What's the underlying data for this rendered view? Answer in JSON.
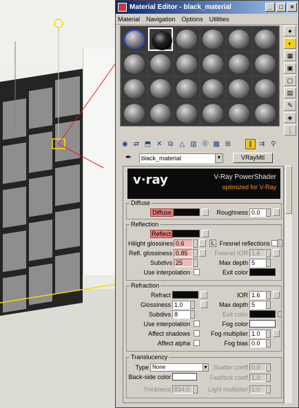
{
  "window": {
    "title": "Material Editor - black_material"
  },
  "menu": [
    "Material",
    "Navigation",
    "Options",
    "Utilities"
  ],
  "material": {
    "name": "black_material",
    "type": "VRayMtl"
  },
  "banner": {
    "logo": "v·ray",
    "title": "V-Ray PowerShader",
    "subtitle": "optimized for V-Ray"
  },
  "diffuse": {
    "group": "Diffuse",
    "diffuse_label": "Diffuse",
    "roughness_label": "Roughness",
    "roughness": "0.0"
  },
  "reflection": {
    "group": "Reflection",
    "reflect_label": "Reflect",
    "hilight_label": "Hilight glossiness",
    "hilight": "0.6",
    "refl_gloss_label": "Refl. glossiness",
    "refl_gloss": "0.85",
    "subdivs_label": "Subdivs",
    "subdivs": "25",
    "use_interp_label": "Use interpolation",
    "l_label": "L",
    "fresnel_label": "Fresnel reflections",
    "fresnel_ior_label": "Fresnel IOR",
    "fresnel_ior": "1.6",
    "max_depth_label": "Max depth",
    "max_depth": "5",
    "exit_color_label": "Exit color"
  },
  "refraction": {
    "group": "Refraction",
    "refract_label": "Refract",
    "glossiness_label": "Glossiness",
    "glossiness": "1.0",
    "subdivs_label": "Subdivs",
    "subdivs": "8",
    "use_interp_label": "Use interpolation",
    "affect_shadows_label": "Affect shadows",
    "affect_alpha_label": "Affect alpha",
    "ior_label": "IOR",
    "ior": "1.6",
    "max_depth_label": "Max depth",
    "max_depth": "5",
    "exit_color_label": "Exit color",
    "fog_color_label": "Fog color",
    "fog_mult_label": "Fog multiplier",
    "fog_mult": "1.0",
    "fog_bias_label": "Fog bias",
    "fog_bias": "0.0"
  },
  "translucency": {
    "group": "Translucency",
    "type_label": "Type",
    "type": "None",
    "backside_label": "Back-side color",
    "thickness_label": "Thickness",
    "thickness": "834.0",
    "scatter_label": "Scatter coeff",
    "scatter": "0.0",
    "fwdbck_label": "Fwd/bck coeff",
    "fwdbck": "1.0",
    "light_mult_label": "Light multiplier",
    "light_mult": "1.0"
  },
  "colors": {
    "highlight": "#e88080",
    "title_bar": "#0a246a",
    "active_tool": "#f2c820"
  }
}
